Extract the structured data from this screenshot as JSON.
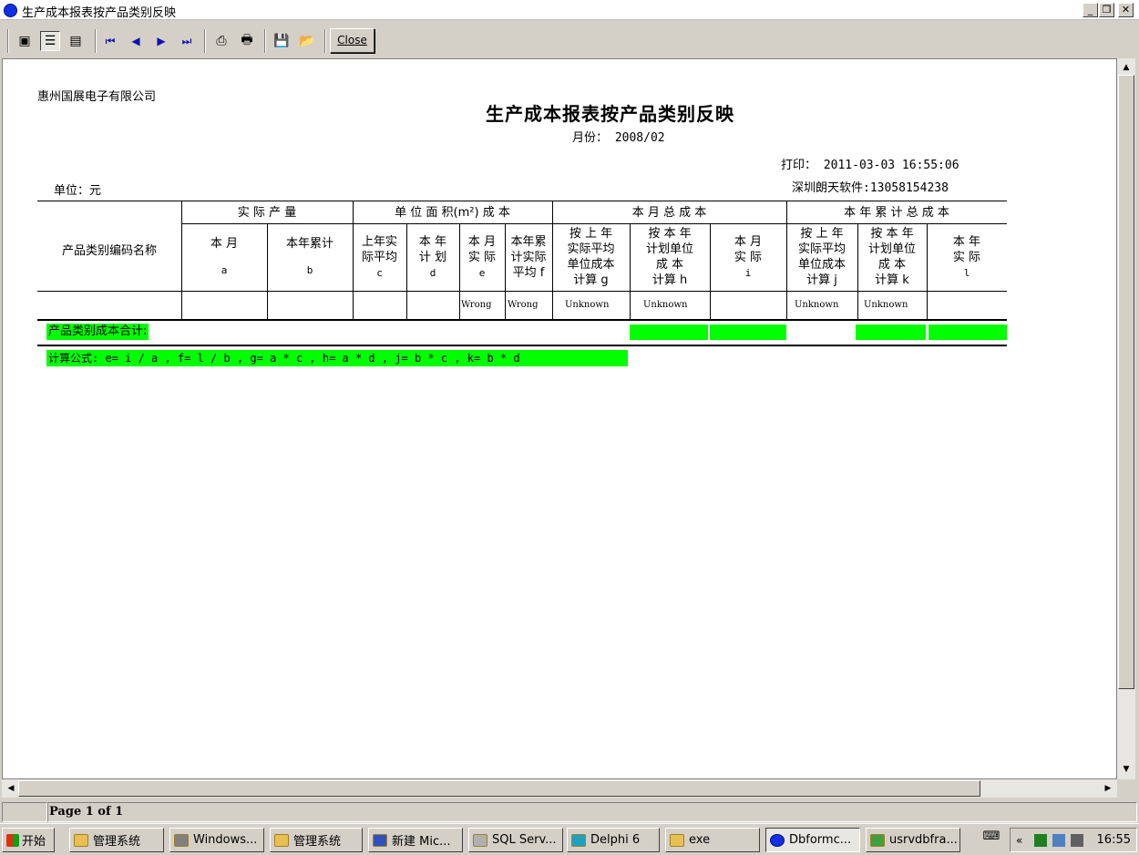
{
  "window": {
    "title": "生产成本报表按产品类别反映",
    "min_label": "_",
    "max_label": "❐",
    "close_label": "✕"
  },
  "toolbar": {
    "close_label": "Close"
  },
  "report": {
    "company": "惠州国展电子有限公司",
    "title": "生产成本报表按产品类别反映",
    "month": "月份：  2008/02",
    "print_time": "打印：  2011-03-03 16:55:06",
    "unit": "单位：元",
    "vendor": "深圳朗天软件:13058154238",
    "groups": {
      "actual_output": "实 际 产 量",
      "unit_area_cost": "单 位 面 积(m²) 成 本",
      "month_total": "本 月 总 成 本",
      "year_total": "本 年 累 计 总 成 本"
    },
    "row_header": "产品类别编码名称",
    "columns": {
      "a": {
        "l1": "本      月",
        "code": "a"
      },
      "b": {
        "l1": "本年累计",
        "code": "b"
      },
      "c": {
        "l1": "上年实",
        "l2": "际平均",
        "code": "c"
      },
      "d": {
        "l1": "本 年",
        "l2": "计 划",
        "code": "d"
      },
      "e": {
        "l1": "本 月",
        "l2": "实 际",
        "code": "e"
      },
      "f": {
        "l1": "本年累",
        "l2": "计实际",
        "l3": "平均 f"
      },
      "g": {
        "l1": "按 上 年",
        "l2": "实际平均",
        "l3": "单位成本",
        "l4": "计算 g"
      },
      "h": {
        "l1": "按 本 年",
        "l2": "计划单位",
        "l3": "成    本",
        "l4": "计算 h"
      },
      "i": {
        "l1": "本 月",
        "l2": "实 际",
        "code": "i"
      },
      "j": {
        "l1": "按 上 年",
        "l2": "实际平均",
        "l3": "单位成本",
        "l4": "计算 j"
      },
      "k": {
        "l1": "按 本 年",
        "l2": "计划单位",
        "l3": "成    本",
        "l4": "计算 k"
      },
      "l": {
        "l1": "本 年",
        "l2": "实 际",
        "code": "l"
      }
    },
    "values": {
      "e": "Wrong",
      "f": "Wrong",
      "g": "Unknown",
      "h": "Unknown",
      "j": "Unknown",
      "k": "Unknown"
    },
    "sum_label": "产品类别成本合计:",
    "formula": "计算公式: e= i / a , f= l / b , g= a * c , h= a * d  , j= b * c , k= b * d"
  },
  "status": {
    "page": "Page 1 of 1"
  },
  "taskbar": {
    "start": "开始",
    "tasks": [
      {
        "label": "管理系统",
        "icon": "folder-icon"
      },
      {
        "label": "Windows...",
        "icon": "monitor-icon"
      },
      {
        "label": "管理系统",
        "icon": "folder-icon"
      },
      {
        "label": "新建 Mic...",
        "icon": "document-icon"
      },
      {
        "label": "SQL Serv...",
        "icon": "database-icon"
      },
      {
        "label": "Delphi 6",
        "icon": "delphi-icon"
      },
      {
        "label": "exe",
        "icon": "folder-icon"
      },
      {
        "label": "Dbformc...",
        "icon": "app-icon"
      },
      {
        "label": "usrvdbfra...",
        "icon": "usr-icon"
      }
    ],
    "clock": "16:55",
    "tray_chevron": "«"
  }
}
